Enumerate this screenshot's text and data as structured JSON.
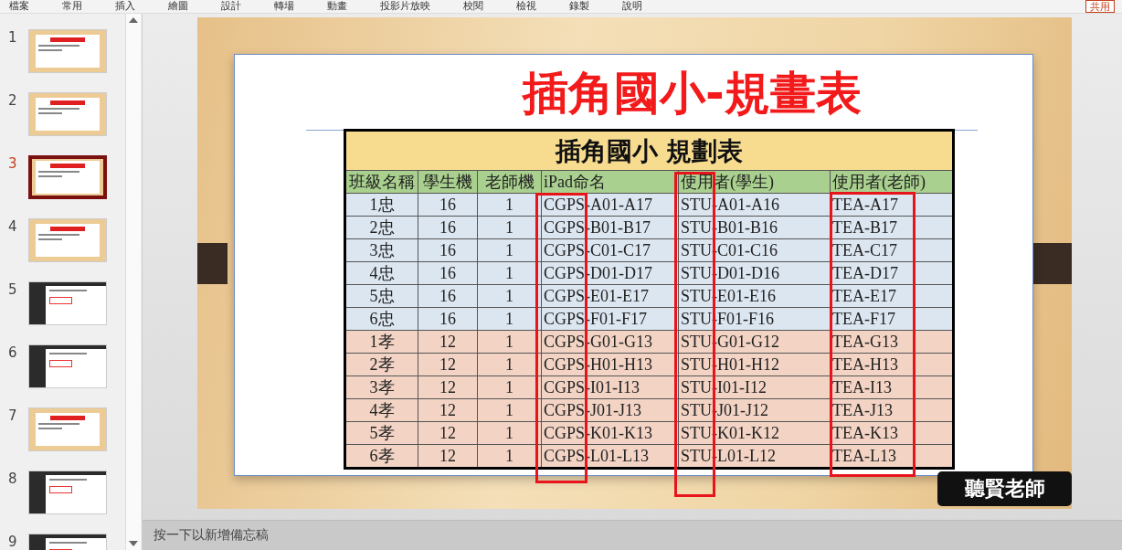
{
  "menu": [
    {
      "label": "檔案"
    },
    {
      "label": "常用"
    },
    {
      "label": "插入"
    },
    {
      "label": "繪圖"
    },
    {
      "label": "設計"
    },
    {
      "label": "轉場"
    },
    {
      "label": "動畫"
    },
    {
      "label": "投影片放映"
    },
    {
      "label": "校閱"
    },
    {
      "label": "檢視"
    },
    {
      "label": "錄製"
    },
    {
      "label": "說明"
    }
  ],
  "share": "共用",
  "slides": [
    {
      "number": "1",
      "kind": "wood",
      "selected": false
    },
    {
      "number": "2",
      "kind": "wood",
      "selected": false
    },
    {
      "number": "3",
      "kind": "wood",
      "selected": true
    },
    {
      "number": "4",
      "kind": "wood",
      "selected": false
    },
    {
      "number": "5",
      "kind": "dark",
      "selected": false
    },
    {
      "number": "6",
      "kind": "dark",
      "selected": false
    },
    {
      "number": "7",
      "kind": "wood",
      "selected": false
    },
    {
      "number": "8",
      "kind": "dark",
      "selected": false
    },
    {
      "number": "9",
      "kind": "dark",
      "selected": false
    }
  ],
  "slide": {
    "title": "插角國小-規畫表",
    "table_title": "插角國小  規劃表",
    "columns": [
      "班級名稱",
      "學生機",
      "老師機",
      "iPad命名",
      "使用者(學生)",
      "使用者(老師)"
    ],
    "rows": [
      {
        "cells": [
          "1忠",
          "16",
          "1",
          "CGPS-A01-A17",
          "STU-A01-A16",
          "TEA-A17"
        ],
        "color": "#dce6f1"
      },
      {
        "cells": [
          "2忠",
          "16",
          "1",
          "CGPS-B01-B17",
          "STU-B01-B16",
          "TEA-B17"
        ],
        "color": "#dce6f1"
      },
      {
        "cells": [
          "3忠",
          "16",
          "1",
          "CGPS-C01-C17",
          "STU-C01-C16",
          "TEA-C17"
        ],
        "color": "#dce6f1"
      },
      {
        "cells": [
          "4忠",
          "16",
          "1",
          "CGPS-D01-D17",
          "STU-D01-D16",
          "TEA-D17"
        ],
        "color": "#dce6f1"
      },
      {
        "cells": [
          "5忠",
          "16",
          "1",
          "CGPS-E01-E17",
          "STU-E01-E16",
          "TEA-E17"
        ],
        "color": "#dce6f1"
      },
      {
        "cells": [
          "6忠",
          "16",
          "1",
          "CGPS-F01-F17",
          "STU-F01-F16",
          "TEA-F17"
        ],
        "color": "#dce6f1"
      },
      {
        "cells": [
          "1孝",
          "12",
          "1",
          "CGPS-G01-G13",
          "STU-G01-G12",
          "TEA-G13"
        ],
        "color": "#f2d3c4"
      },
      {
        "cells": [
          "2孝",
          "12",
          "1",
          "CGPS-H01-H13",
          "STU-H01-H12",
          "TEA-H13"
        ],
        "color": "#f2d3c4"
      },
      {
        "cells": [
          "3孝",
          "12",
          "1",
          "CGPS-I01-I13",
          "STU-I01-I12",
          "TEA-I13"
        ],
        "color": "#f2d3c4"
      },
      {
        "cells": [
          "4孝",
          "12",
          "1",
          "CGPS-J01-J13",
          "STU-J01-J12",
          "TEA-J13"
        ],
        "color": "#f2d3c4"
      },
      {
        "cells": [
          "5孝",
          "12",
          "1",
          "CGPS-K01-K13",
          "STU-K01-K12",
          "TEA-K13"
        ],
        "color": "#f2d3c4"
      },
      {
        "cells": [
          "6孝",
          "12",
          "1",
          "CGPS-L01-L13",
          "STU-L01-L12",
          "TEA-L13"
        ],
        "color": "#f2d3c4"
      }
    ],
    "badge": "聽賢老師"
  },
  "notes": {
    "placeholder": "按一下以新增備忘稿"
  }
}
